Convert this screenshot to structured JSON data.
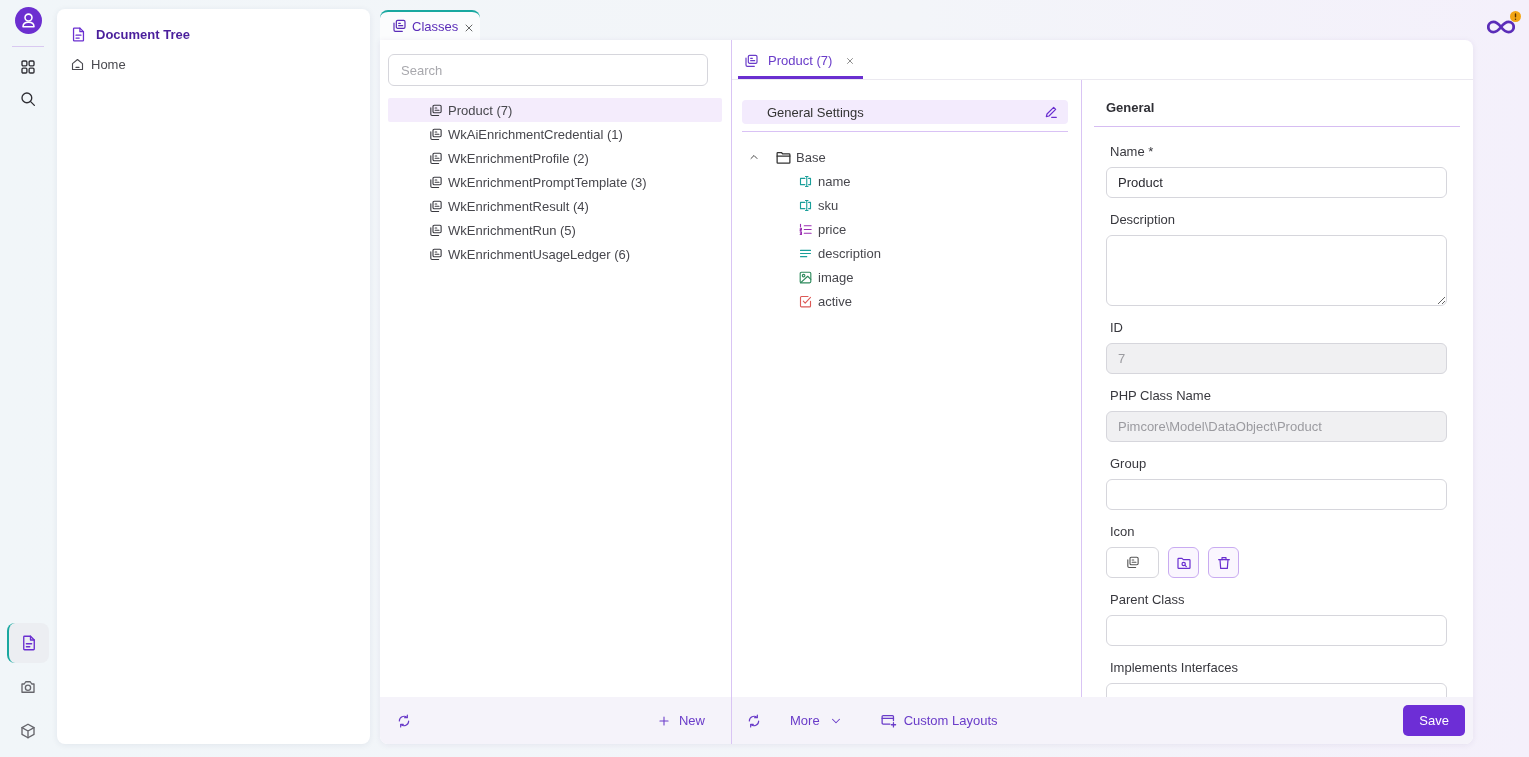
{
  "rail": {
    "top": [
      {
        "kind": "apps",
        "selected": false
      },
      {
        "kind": "search",
        "selected": false
      }
    ],
    "bottom": [
      {
        "kind": "documents",
        "selected": true
      },
      {
        "kind": "assets",
        "selected": false
      },
      {
        "kind": "data-objects",
        "selected": false
      }
    ]
  },
  "doc_panel": {
    "title": "Document Tree",
    "items": [
      {
        "kind": "home",
        "label": "Home"
      }
    ]
  },
  "tabs": [
    {
      "label": "Classes",
      "selected": true
    }
  ],
  "class_list": {
    "search": {
      "placeholder": "Search"
    },
    "items": [
      {
        "label": "Product (7)",
        "selected": true
      },
      {
        "label": "WkAiEnrichmentCredential (1)",
        "selected": false
      },
      {
        "label": "WkEnrichmentProfile (2)",
        "selected": false
      },
      {
        "label": "WkEnrichmentPromptTemplate (3)",
        "selected": false
      },
      {
        "label": "WkEnrichmentResult (4)",
        "selected": false
      },
      {
        "label": "WkEnrichmentRun (5)",
        "selected": false
      },
      {
        "label": "WkEnrichmentUsageLedger (6)",
        "selected": false
      }
    ],
    "footer": {
      "new_label": "New"
    }
  },
  "editor": {
    "tabs": [
      {
        "label": "Product (7)",
        "selected": true
      }
    ],
    "layout_tree": {
      "label": "General Settings",
      "selected": true,
      "children": [
        {
          "label": "Base",
          "expanded": true,
          "children": [
            {
              "label": "name",
              "kind": "input"
            },
            {
              "label": "sku",
              "kind": "input"
            },
            {
              "label": "price",
              "kind": "numeric"
            },
            {
              "label": "description",
              "kind": "textarea"
            },
            {
              "label": "image",
              "kind": "image"
            },
            {
              "label": "active",
              "kind": "checkbox"
            }
          ]
        }
      ]
    },
    "form": {
      "title": "General",
      "fields": [
        {
          "kind": "text",
          "label": "Name *",
          "value": "Product",
          "disabled": false
        },
        {
          "kind": "textarea",
          "label": "Description",
          "disabled": false
        },
        {
          "kind": "text",
          "label": "ID",
          "value": "7",
          "disabled": true
        },
        {
          "kind": "text",
          "label": "PHP Class Name",
          "value": "Pimcore\\Model\\DataObject\\Product",
          "disabled": true
        },
        {
          "kind": "text",
          "label": "Group",
          "disabled": false
        },
        {
          "kind": "icon",
          "label": "Icon",
          "disabled": false
        },
        {
          "kind": "text",
          "label": "Parent Class",
          "disabled": false
        },
        {
          "kind": "text",
          "label": "Implements Interfaces",
          "disabled": false
        }
      ]
    },
    "footer": {
      "more_label": "More",
      "custom_layouts_label": "Custom Layouts",
      "save_label": "Save"
    }
  }
}
